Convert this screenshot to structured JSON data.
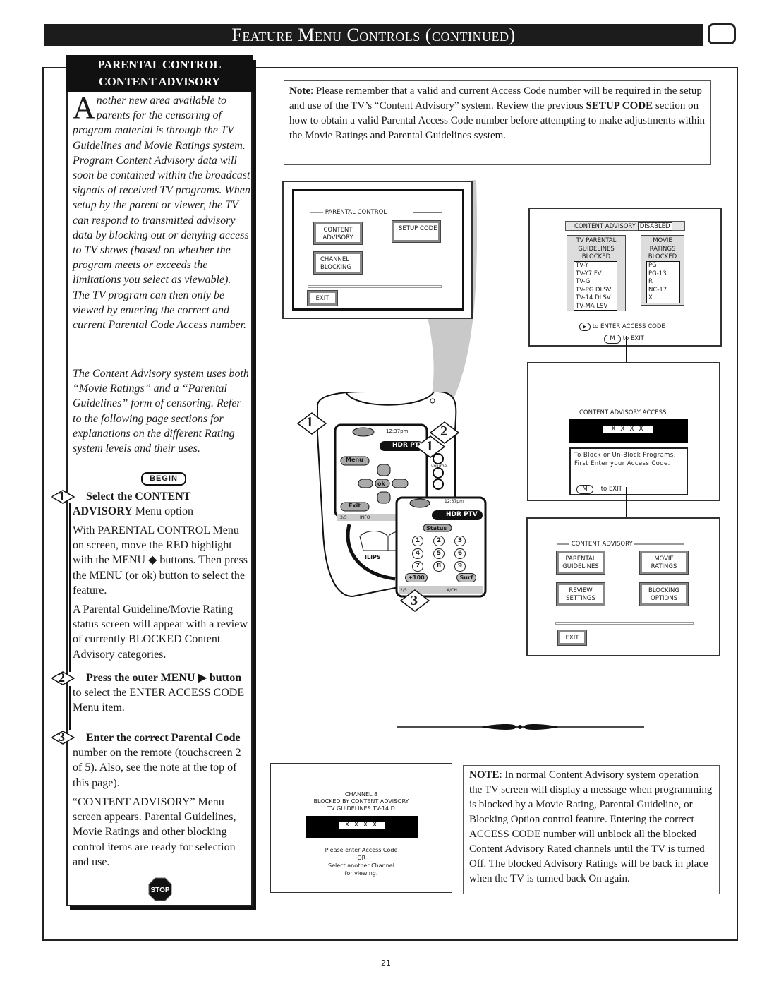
{
  "header": {
    "title": "Feature Menu Controls (continued)",
    "tv_icon": "tv-screen-icon"
  },
  "sidebar": {
    "heading_line1": "PARENTAL CONTROL",
    "heading_line2": "CONTENT ADVISORY",
    "intro_dropcap": "A",
    "intro_text": "nother new area available to parents for the censoring of program material is through the TV Guidelines and Movie Ratings system. Program Content Advisory data will soon be contained within the broadcast signals of received TV programs. When setup by the parent or viewer, the TV can respond to transmitted advisory data by blocking out or denying access to TV shows (based on whether the program meets or exceeds the limitations you select as viewable). The TV program can then only be viewed by entering the correct and current Parental Code Access number.",
    "intro_text2": "The Content Advisory system uses both “Movie Ratings” and a “Parental Guidelines” form of censoring. Refer to the following page sections for explanations on the different Rating system levels and their uses.",
    "begin_label": "BEGIN",
    "steps": [
      {
        "number": "1",
        "title_bold": "Select the CONTENT ADVISORY",
        "title_rest": " Menu option",
        "body": [
          "With PARENTAL CONTROL Menu on screen, move the RED highlight with the MENU ◆ buttons. Then press the MENU (or ok) button to select the feature.",
          "A Parental Guideline/Movie Rating status screen will appear with a review of currently BLOCKED Content Advisory categories."
        ]
      },
      {
        "number": "2",
        "title_bold": "Press the outer MENU ▶ button",
        "title_rest": " to select the ENTER ACCESS CODE Menu item.",
        "body": []
      },
      {
        "number": "3",
        "title_bold": "Enter the correct Parental Code",
        "title_rest": " number on the remote (touchscreen 2 of 5). Also, see the note at the top of this page).",
        "body": [
          "“CONTENT ADVISORY” Menu screen appears. Parental Guidelines, Movie Ratings and other blocking control items are ready for selection and use."
        ]
      }
    ],
    "stop_label": "STOP"
  },
  "top_note": {
    "label": "Note",
    "text_a": ": Please remember that a valid and current Access Code number will be required in the setup and use of the TV’s “Content Advisory” system. Review the previous ",
    "bold": "SETUP CODE",
    "text_b": " section on how to obtain a valid Parental Access Code number before attempting to make adjustments within the Movie Ratings and Parental Guidelines system."
  },
  "screen_parental": {
    "title": "PARENTAL CONTROL",
    "buttons": [
      "CONTENT ADVISORY",
      "SETUP CODE",
      "CHANNEL BLOCKING",
      "EXIT"
    ]
  },
  "screen_status": {
    "label": "CONTENT ADVISORY",
    "status": "DISABLED",
    "tv_heading": "TV PARENTAL GUIDELINES BLOCKED",
    "tv_items": [
      "TV-Y",
      "TV-Y7  FV",
      "TV-G",
      "TV-PG DLSV",
      "TV-14  DLSV",
      "TV-MA LSV"
    ],
    "movie_heading": "MOVIE RATINGS BLOCKED",
    "movie_items": [
      "PG",
      "PG-13",
      "R",
      "NC-17",
      "X"
    ],
    "enter_hint": "to ENTER ACCESS CODE",
    "exit_key": "M",
    "exit_hint": "to EXIT"
  },
  "screen_access": {
    "title": "CONTENT ADVISORY ACCESS",
    "code": "X X X X",
    "message": "To Block or Un-Block Programs, First Enter your Access Code.",
    "exit_key": "M",
    "exit_hint": "to EXIT"
  },
  "screen_menu": {
    "title": "CONTENT ADVISORY",
    "buttons": [
      "PARENTAL GUIDELINES",
      "MOVIE RATINGS",
      "REVIEW SETTINGS",
      "BLOCKING OPTIONS"
    ],
    "exit": "EXIT"
  },
  "remote": {
    "time": "12:37pm",
    "device": "HDR PTV",
    "menu": "Menu",
    "ok": "ok",
    "exit": "Exit",
    "volume": "volume",
    "page1": "3/5",
    "info": "INFO",
    "status": "Status",
    "keys": [
      "1",
      "2",
      "3",
      "4",
      "5",
      "6",
      "7",
      "8",
      "9"
    ],
    "plus100": "+100",
    "surf": "Surf",
    "page2": "2/5",
    "ach": "A/CH",
    "brand": "ILIPS",
    "callouts": [
      "1",
      "2",
      "1",
      "3"
    ]
  },
  "screen_blocked": {
    "line1": "CHANNEL 8",
    "line2": "BLOCKED BY CONTENT ADVISORY",
    "line3": "TV GUIDELINES TV-14  D",
    "code": "X X X X",
    "hint1": "Please enter Access Code",
    "hint2": "-OR-",
    "hint3": "Select another Channel",
    "hint4": "for viewing."
  },
  "bottom_note": {
    "label": "NOTE",
    "text": ": In normal Content Advisory system operation the TV screen will display a message when programming is blocked by a Movie Rating, Parental Guideline, or Blocking Option control feature. Entering the correct ACCESS CODE number will unblock all the blocked Content Advisory Rated channels until the TV is turned Off. The blocked Advisory Ratings will be back in place when the TV is turned back On again."
  },
  "page_number": "21"
}
